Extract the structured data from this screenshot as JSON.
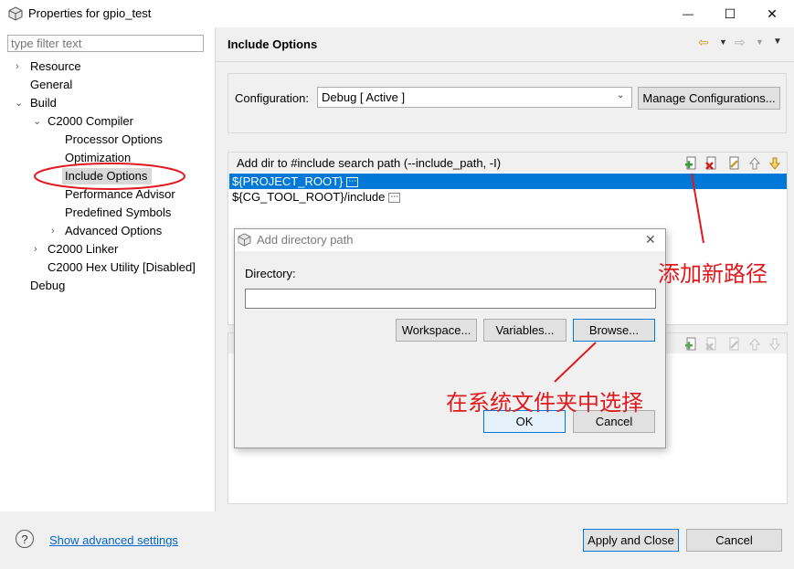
{
  "window": {
    "title": "Properties for gpio_test",
    "controls": {
      "minimize": "—",
      "maximize": "☐",
      "close": "✕"
    }
  },
  "filter": {
    "placeholder": "type filter text"
  },
  "tree": {
    "resource": "Resource",
    "general": "General",
    "build": "Build",
    "c2000_compiler": "C2000 Compiler",
    "processor_options": "Processor Options",
    "optimization": "Optimization",
    "include_options": "Include Options",
    "performance_advisor": "Performance Advisor",
    "predefined_symbols": "Predefined Symbols",
    "advanced_options": "Advanced Options",
    "c2000_linker": "C2000 Linker",
    "c2000_hex_utility": "C2000 Hex Utility  [Disabled]",
    "debug": "Debug"
  },
  "page": {
    "title": "Include Options"
  },
  "configuration": {
    "label": "Configuration:",
    "value": "Debug  [ Active ]",
    "manage_button": "Manage Configurations..."
  },
  "include_paths": {
    "header": "Add dir to #include search path (--include_path, -I)",
    "items": [
      "${PROJECT_ROOT}",
      "${CG_TOOL_ROOT}/include"
    ]
  },
  "dialog": {
    "title": "Add directory path",
    "directory_label": "Directory:",
    "directory_value": "",
    "workspace_button": "Workspace...",
    "variables_button": "Variables...",
    "browse_button": "Browse...",
    "ok_button": "OK",
    "cancel_button": "Cancel"
  },
  "footer": {
    "help_icon": "?",
    "advanced_link": "Show advanced settings",
    "apply_close_button": "Apply and Close",
    "cancel_button": "Cancel"
  },
  "annotations": {
    "add_new_path": "添加新路径",
    "choose_in_system_folder": "在系统文件夹中选择",
    "color": "#e0191e"
  }
}
